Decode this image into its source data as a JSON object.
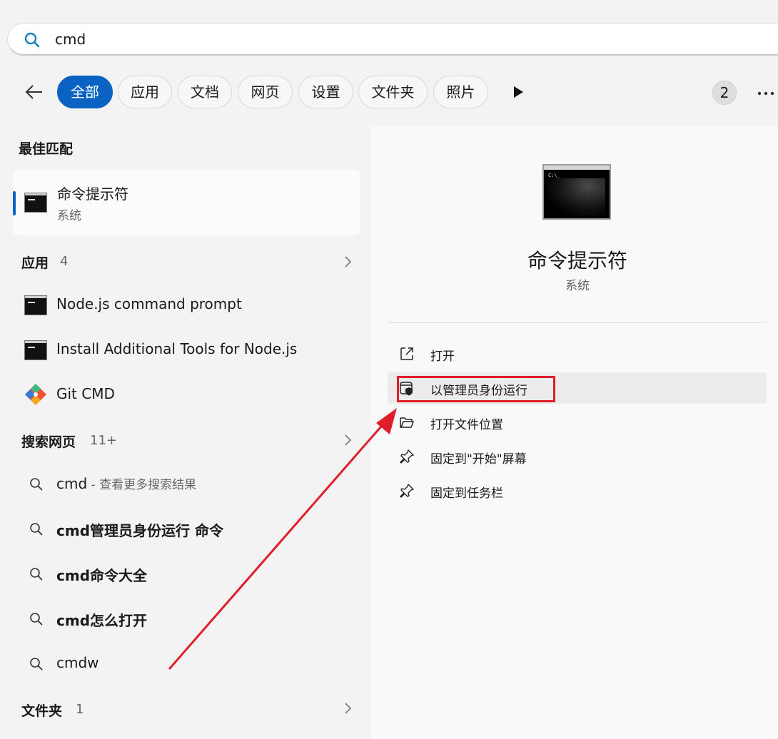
{
  "search": {
    "value": "cmd"
  },
  "filters": {
    "chips": [
      "全部",
      "应用",
      "文档",
      "网页",
      "设置",
      "文件夹",
      "照片"
    ],
    "badge": "2"
  },
  "best_match": {
    "heading": "最佳匹配",
    "title": "命令提示符",
    "subtitle": "系统"
  },
  "apps": {
    "heading": "应用",
    "count": "4",
    "items": [
      "Node.js command prompt",
      "Install Additional Tools for Node.js",
      "Git CMD"
    ]
  },
  "web": {
    "heading": "搜索网页",
    "count": "11+",
    "items": [
      {
        "text": "cmd",
        "suffix": " - 查看更多搜索结果"
      },
      {
        "text": "cmd管理员身份运行 命令",
        "suffix": ""
      },
      {
        "text": "cmd命令大全",
        "suffix": ""
      },
      {
        "text": "cmd怎么打开",
        "suffix": ""
      },
      {
        "text": "cmdw",
        "suffix": ""
      }
    ]
  },
  "folders": {
    "heading": "文件夹",
    "count": "1"
  },
  "detail": {
    "icon_text": "C:\\_",
    "title": "命令提示符",
    "subtitle": "系统",
    "actions": [
      "打开",
      "以管理员身份运行",
      "打开文件位置",
      "固定到\"开始\"屏幕",
      "固定到任务栏"
    ]
  },
  "colors": {
    "accent": "#0a63c2",
    "annotation": "#e01e2b"
  }
}
